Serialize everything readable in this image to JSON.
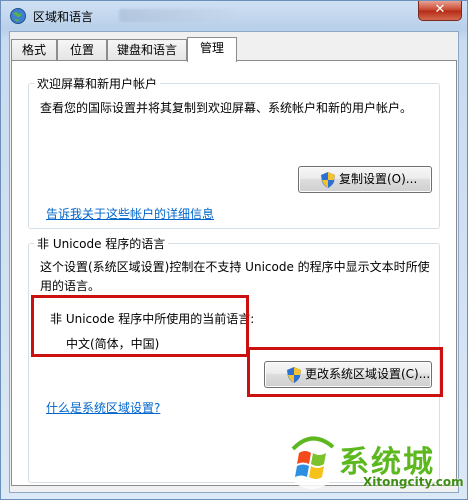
{
  "window": {
    "title": "区域和语言",
    "close_symbol": "✕"
  },
  "tabs": [
    {
      "label": "格式"
    },
    {
      "label": "位置"
    },
    {
      "label": "键盘和语言"
    },
    {
      "label": "管理"
    }
  ],
  "welcome_group": {
    "title": "欢迎屏幕和新用户帐户",
    "description": "查看您的国际设置并将其复制到欢迎屏幕、系统帐户和新的用户帐户。",
    "copy_button_label": "复制设置(O)...",
    "link_text": "告诉我关于这些帐户的详细信息"
  },
  "unicode_group": {
    "title": "非 Unicode 程序的语言",
    "description_line1": "这个设置(系统区域设置)控制在不支持 Unicode 的程序中显示文本时所使",
    "description_line2": "用的语言。",
    "current_language_label": "非 Unicode 程序中所使用的当前语言:",
    "current_language_value": "中文(简体，中国)",
    "change_button_label": "更改系统区域设置(C)...",
    "link_text": "什么是系统区域设置?"
  },
  "watermark": {
    "brand": "系统城",
    "url": "Xitongcity.com"
  },
  "colors": {
    "link": "#0066cc",
    "highlight_border": "#cc1010",
    "watermark_green": "#5db81f"
  }
}
